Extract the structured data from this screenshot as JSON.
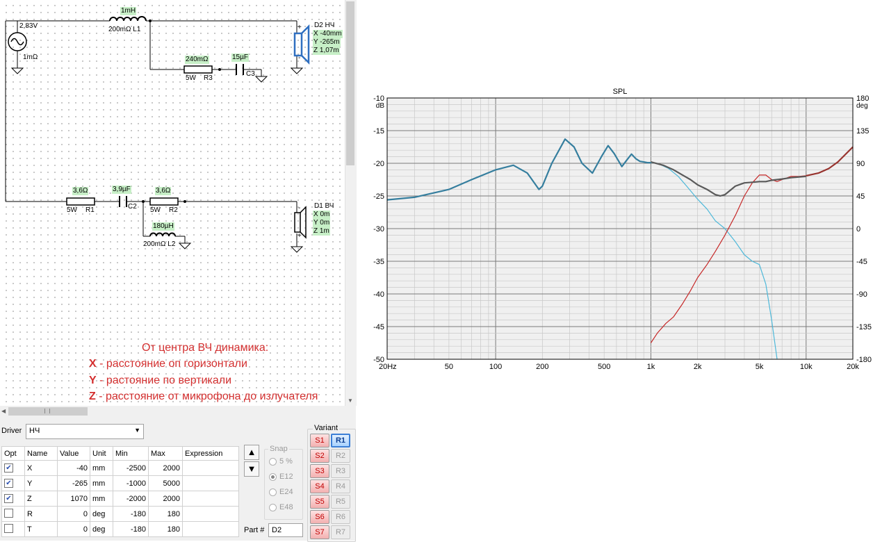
{
  "schematic": {
    "source": {
      "voltage": "2,83V",
      "resistance": "1mΩ"
    },
    "L1": {
      "value": "1mH",
      "desc": "200mΩ L1"
    },
    "R3": {
      "value": "240mΩ",
      "power": "5W",
      "name": "R3"
    },
    "C3": {
      "value": "15µF",
      "name": "C3"
    },
    "D2": {
      "name": "D2 НЧ",
      "x": "X -40mm",
      "y": "Y -265m",
      "z": "Z 1,07m"
    },
    "R1": {
      "value": "3,6Ω",
      "power": "5W",
      "name": "R1"
    },
    "C2": {
      "value": "3,9µF",
      "name": "C2"
    },
    "R2": {
      "value": "3,6Ω",
      "power": "5W",
      "name": "R2"
    },
    "L2": {
      "value": "180µH",
      "desc": "200mΩ L2"
    },
    "D1": {
      "name": "D1 ВЧ",
      "x": "X 0m",
      "y": "Y 0m",
      "z": "Z 1m"
    },
    "note": {
      "title": "От центра ВЧ динамика:",
      "lines": [
        {
          "key": "X",
          "text": " - расстояние оп горизонтали"
        },
        {
          "key": "Y",
          "text": " - растояние по вертикали"
        },
        {
          "key": "Z",
          "text": " - расстояние от микрофона до излучателя"
        }
      ]
    }
  },
  "driver": {
    "label": "Driver",
    "selected": "НЧ",
    "columns": [
      "Opt",
      "Name",
      "Value",
      "Unit",
      "Min",
      "Max",
      "Expression"
    ],
    "rows": [
      {
        "opt": true,
        "name": "X",
        "value": "-40",
        "unit": "mm",
        "min": "-2500",
        "max": "2000",
        "expr": ""
      },
      {
        "opt": true,
        "name": "Y",
        "value": "-265",
        "unit": "mm",
        "min": "-1000",
        "max": "5000",
        "expr": ""
      },
      {
        "opt": true,
        "name": "Z",
        "value": "1070",
        "unit": "mm",
        "min": "-2000",
        "max": "2000",
        "expr": ""
      },
      {
        "opt": false,
        "name": "R",
        "value": "0",
        "unit": "deg",
        "min": "-180",
        "max": "180",
        "expr": ""
      },
      {
        "opt": false,
        "name": "T",
        "value": "0",
        "unit": "deg",
        "min": "-180",
        "max": "180",
        "expr": ""
      }
    ]
  },
  "snap": {
    "label": "Snap",
    "options": [
      "5 %",
      "E12",
      "E24",
      "E48"
    ],
    "selected": "E12"
  },
  "part": {
    "label": "Part #",
    "value": "D2"
  },
  "variant": {
    "label": "Variant",
    "s": [
      "S1",
      "S2",
      "S3",
      "S4",
      "S5",
      "S6",
      "S7"
    ],
    "r": [
      "R1",
      "R2",
      "R3",
      "R4",
      "R5",
      "R6",
      "R7"
    ],
    "active_r": "R1"
  },
  "chart_data": {
    "type": "line",
    "title": "SPL",
    "ylabel": "dB",
    "y2label": "deg",
    "x_scale": "log",
    "xlim": [
      20,
      20000
    ],
    "ylim": [
      -50,
      -10
    ],
    "y2lim": [
      -180,
      180
    ],
    "x_ticks": [
      20,
      50,
      100,
      200,
      500,
      1000,
      2000,
      5000,
      10000,
      20000
    ],
    "x_tick_labels": [
      "20Hz",
      "50",
      "100",
      "200",
      "500",
      "1k",
      "2k",
      "5k",
      "10k",
      "20k"
    ],
    "y_ticks": [
      -10,
      -15,
      -20,
      -25,
      -30,
      -35,
      -40,
      -45,
      -50
    ],
    "y2_ticks": [
      180,
      135,
      90,
      45,
      0,
      -45,
      -90,
      -135,
      -180
    ],
    "grid": true,
    "series": [
      {
        "color": "#4db8d9",
        "x": [
          20,
          30,
          50,
          70,
          100,
          130,
          160,
          190,
          200,
          230,
          280,
          320,
          360,
          420,
          480,
          530,
          580,
          650,
          700,
          750,
          800,
          850,
          900,
          950,
          1000,
          1100,
          1300,
          1500,
          1700,
          2000,
          2300,
          2600,
          3000,
          3500,
          4000,
          4500,
          5000,
          5500,
          6000,
          6500
        ],
        "y": [
          -25.6,
          -25.2,
          -24.0,
          -22.5,
          -21.0,
          -20.3,
          -21.5,
          -24.0,
          -23.5,
          -20.0,
          -16.3,
          -17.5,
          -20.0,
          -21.5,
          -19.0,
          -17.3,
          -18.5,
          -20.5,
          -19.5,
          -18.6,
          -19.3,
          -19.7,
          -19.8,
          -19.9,
          -19.9,
          -20.0,
          -20.8,
          -22.0,
          -23.5,
          -25.5,
          -27.0,
          -28.8,
          -30.0,
          -32.0,
          -34.0,
          -35.0,
          -35.5,
          -38.5,
          -44.0,
          -50.0
        ]
      },
      {
        "color": "#c62828",
        "x": [
          1000,
          1100,
          1250,
          1400,
          1600,
          1800,
          2000,
          2300,
          2600,
          3000,
          3500,
          4000,
          4500,
          5000,
          5500,
          6000,
          6500,
          7000,
          8000,
          9000,
          10000,
          12000,
          14000,
          16000,
          20000
        ],
        "y": [
          -47.5,
          -46.0,
          -44.5,
          -43.5,
          -41.5,
          -39.5,
          -37.5,
          -35.5,
          -33.5,
          -31.0,
          -28.0,
          -25.0,
          -23.0,
          -21.8,
          -21.8,
          -22.5,
          -22.8,
          -22.5,
          -22.0,
          -22.0,
          -21.9,
          -21.5,
          -20.8,
          -19.8,
          -17.5
        ]
      },
      {
        "color": "#5a5a5a",
        "x": [
          1000,
          1200,
          1400,
          1600,
          1800,
          2000,
          2300,
          2600,
          2800,
          3000,
          3500,
          4000,
          4500,
          5000,
          5500,
          6000,
          7000,
          8000,
          10000
        ],
        "y": [
          -19.8,
          -20.3,
          -21.0,
          -21.8,
          -22.5,
          -23.3,
          -24.0,
          -24.8,
          -25.0,
          -24.8,
          -23.5,
          -23.0,
          -22.9,
          -22.8,
          -22.8,
          -22.6,
          -22.4,
          -22.2,
          -22.0
        ]
      },
      {
        "color": "#357e9e",
        "x": [
          20,
          30,
          50,
          70,
          100,
          130,
          160,
          190,
          200,
          230,
          280,
          320,
          360,
          420,
          480,
          530,
          580,
          650,
          700,
          750,
          800,
          850,
          900,
          950,
          1000
        ],
        "y": [
          -25.6,
          -25.2,
          -24.0,
          -22.5,
          -21.0,
          -20.3,
          -21.5,
          -24.0,
          -23.5,
          -20.0,
          -16.3,
          -17.5,
          -20.0,
          -21.5,
          -19.0,
          -17.3,
          -18.5,
          -20.5,
          -19.5,
          -18.6,
          -19.3,
          -19.7,
          -19.8,
          -19.9,
          -19.9
        ]
      },
      {
        "color": "#98332e",
        "x": [
          10000,
          12000,
          14000,
          16000,
          20000
        ],
        "y": [
          -21.9,
          -21.5,
          -20.8,
          -19.8,
          -17.5
        ]
      }
    ]
  }
}
